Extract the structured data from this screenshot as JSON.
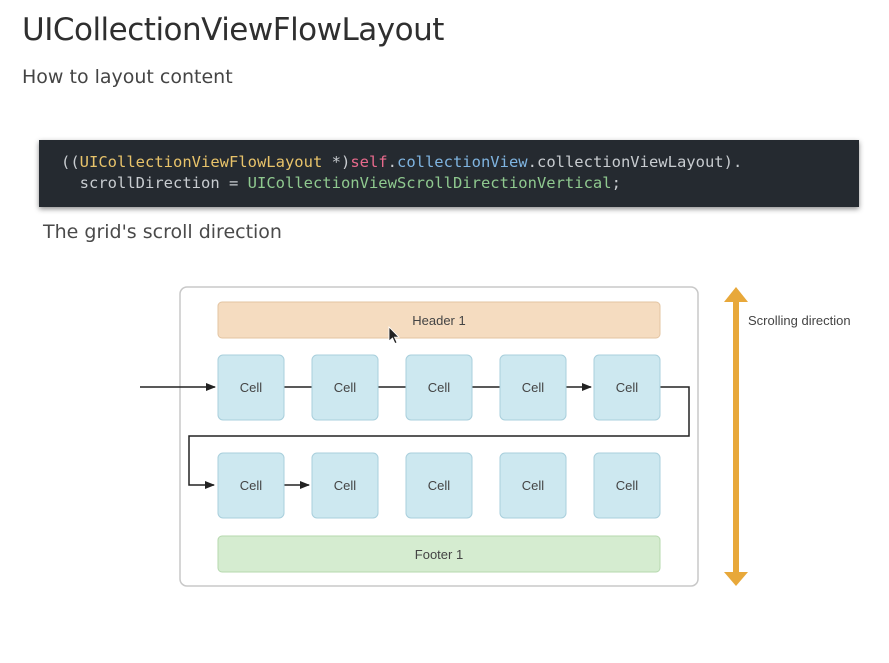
{
  "page": {
    "title": "UICollectionViewFlowLayout",
    "subtitle": "How to layout content",
    "caption": "The grid's scroll direction"
  },
  "code": {
    "line1": {
      "open": "((",
      "type": "UICollectionViewFlowLayout",
      "cast_end": " *)",
      "self": "self",
      "dot1": ".",
      "prop1": "collectionView",
      "dot2": ".",
      "prop2": "collectionViewLayout",
      "close": ")."
    },
    "line2": {
      "indent": "  ",
      "prop": "scrollDirection",
      "assign": " = ",
      "value": "UICollectionViewScrollDirectionVertical",
      "end": ";"
    }
  },
  "diagram": {
    "header_label": "Header 1",
    "footer_label": "Footer 1",
    "cells_row1": [
      "Cell",
      "Cell",
      "Cell",
      "Cell",
      "Cell"
    ],
    "cells_row2": [
      "Cell",
      "Cell",
      "Cell",
      "Cell",
      "Cell"
    ],
    "scroll_label": "Scrolling direction",
    "colors": {
      "header_fill": "#f5dcc0",
      "cell_fill": "#cde8f0",
      "footer_fill": "#d5ecd0",
      "scroll_arrow": "#e8a83a"
    }
  }
}
